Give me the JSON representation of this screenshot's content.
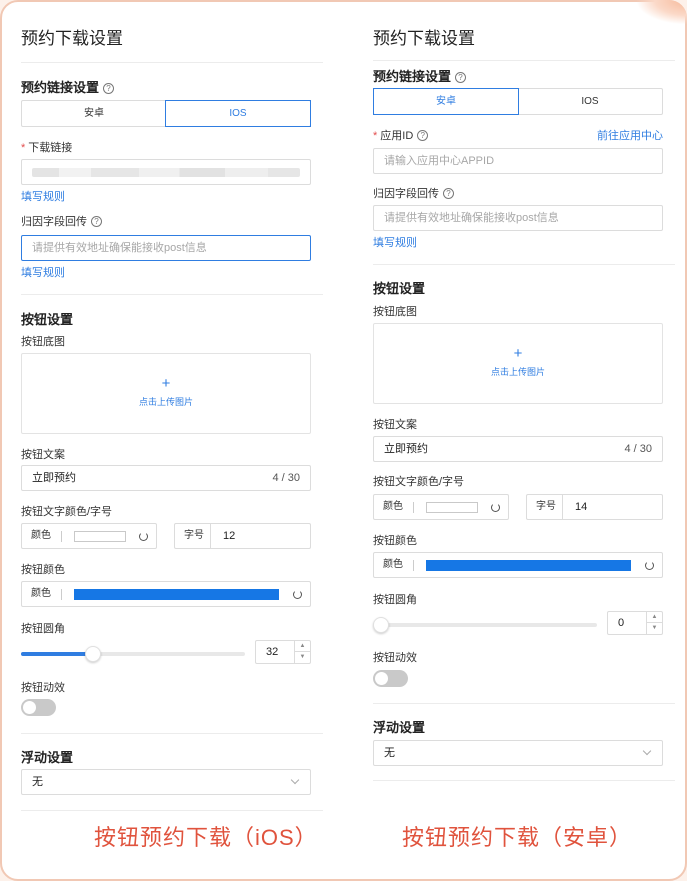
{
  "colors": {
    "accent": "#2f7de1",
    "button_color": "#1677e5",
    "caption": "#e0533d",
    "required": "#e34d4d"
  },
  "left": {
    "title": "预约下载设置",
    "link_section": "预约链接设置",
    "platform_tabs": [
      "安卓",
      "IOS"
    ],
    "download_link_label": "下载链接",
    "rules_link": "填写规则",
    "attribution_label": "归因字段回传",
    "attribution_placeholder": "请提供有效地址确保能接收post信息",
    "rules_link2": "填写规则",
    "button_section": "按钮设置",
    "button_bg_label": "按钮底图",
    "upload_text": "点击上传图片",
    "upload_plus": "+",
    "button_text_label": "按钮文案",
    "button_text_value": "立即预约",
    "button_text_counter": "4 / 30",
    "font_color_size_label": "按钮文字颜色/字号",
    "color_tag": "颜色",
    "size_tag": "字号",
    "font_size_value": "12",
    "button_color_label": "按钮颜色",
    "color_tag2": "颜色",
    "radius_label": "按钮圆角",
    "radius_value": "32",
    "radius_fraction": 0.32,
    "animation_label": "按钮动效",
    "animation_on": false,
    "float_section": "浮动设置",
    "float_value": "无",
    "caption": "按钮预约下载（iOS）"
  },
  "right": {
    "title": "预约下载设置",
    "link_section": "预约链接设置",
    "platform_tabs": [
      "安卓",
      "IOS"
    ],
    "app_id_label": "应用ID",
    "app_center_link": "前往应用中心",
    "app_id_placeholder": "请输入应用中心APPID",
    "attribution_label": "归因字段回传",
    "attribution_placeholder": "请提供有效地址确保能接收post信息",
    "rules_link": "填写规则",
    "button_section": "按钮设置",
    "button_bg_label": "按钮底图",
    "upload_text": "点击上传图片",
    "upload_plus": "+",
    "button_text_label": "按钮文案",
    "button_text_value": "立即预约",
    "button_text_counter": "4 / 30",
    "font_color_size_label": "按钮文字颜色/字号",
    "color_tag": "颜色",
    "size_tag": "字号",
    "font_size_value": "14",
    "button_color_label": "按钮颜色",
    "color_tag2": "颜色",
    "radius_label": "按钮圆角",
    "radius_value": "0",
    "radius_fraction": 0,
    "animation_label": "按钮动效",
    "animation_on": false,
    "float_section": "浮动设置",
    "float_value": "无",
    "caption": "按钮预约下载（安卓）"
  }
}
